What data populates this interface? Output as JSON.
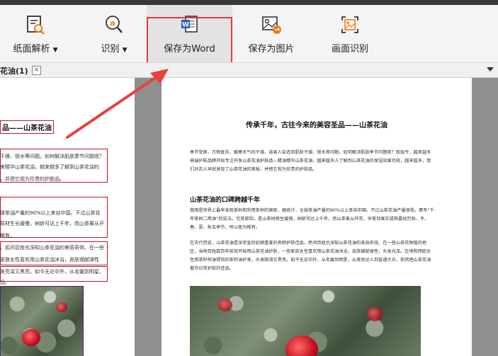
{
  "toolbar": {
    "items": [
      {
        "label": "纸面解析",
        "icon": "doc-magnifier-icon",
        "has_dropdown": true
      },
      {
        "label": "识别",
        "icon": "ocr-a-magnifier-icon",
        "has_dropdown": true
      },
      {
        "label": "保存为Word",
        "icon": "word-doc-icon",
        "active": true
      },
      {
        "label": "保存为图片",
        "icon": "image-export-icon"
      },
      {
        "label": "画面识别",
        "icon": "screen-capture-icon"
      }
    ]
  },
  "tab": {
    "title": "花油(1)",
    "close": "×"
  },
  "left_page": {
    "title": "品——山茶花油",
    "lines": [
      "干燥、锁水等问题。如何解决肌肤季节问题呢？",
      "来精华山茶花油，越来越多了解到山茶花油的",
      "，并把它视为珍贵的护肤品。",
      "球茶油产量的90%以上来自中国。不过山茶花",
      "原材生长缓慢，树龄可达上千年，而山茶果从开",
      "稀有。",
      "，民间百姓也深知山茶花油的美容奇效。在一些",
      "家族女性喜欢用山茶花油沐浴，皮肤细腻弹性",
      "发亮泽又黑亮。如今无论中外，从名媛到明星，",
      "品。"
    ]
  },
  "right_page": {
    "title": "传承千年，古往今来的美容圣品——山茶花油",
    "para1": "季节变换，万物复苏，暖寒天气的干燥，容易人会造到肌肤干燥、锁水等问题。如何解决肌肤季节问题呢？现如今，越来越多高端护肤品牌开始专注开发山茶花油护肤品—精油精华山茶花油，越来越多人了解到山茶花油的保湿效果功效，越来越多，我们对古人早就发现了山茶花油的奥秘，并把它视为珍贵的护肤品。",
    "heading": "山茶花油的口碑跨越千年",
    "para2": "我国是世界上最早发现茶树和利用茶树的国家，据统计，全球茶油产量的90%以上来自中国。不过山茶花油产量很低，素有“千年茶树二两油”的说法。究其原因，是山茶树原生缓慢，树龄可达上千年，而山茶果从开花、孕育到果实成熟要经历秋、冬、春、夏、秋五季节，所以极为稀有。",
    "para3": "在古代宫廷，山茶花油是深受皇后妃嫔喜爱的养颜护肤佳品，民间百姓也深知山茶花油的美容奇效。在一些山茶花种植的地区，当地百姓数百年前就开始用山茶花油护肤，一些家族女性喜欢用山茶花油沐浴，皮肤细腻弹性，头发光泽。在地和西欧女性用茶籽榨油得到的茶籽油护发，头发顺滑又黑亮。如今无论中外，从名媛到明星，从美妆达人到普通大众，依然把山茶花油看作日常护肤的佳品。"
  }
}
